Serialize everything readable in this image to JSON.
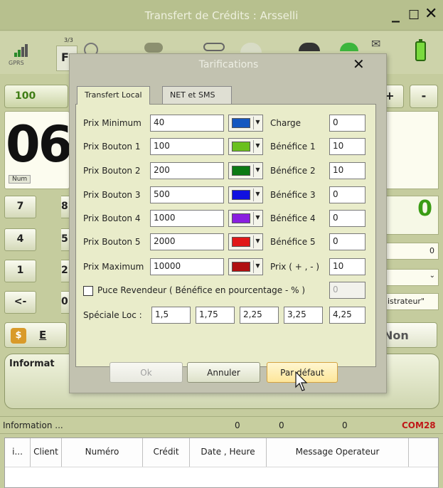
{
  "window": {
    "title": "Transfert de Crédits : Arsselli"
  },
  "toolbar": {
    "gprs": "GPRS",
    "page_count": "3/3",
    "p_label": "F"
  },
  "amounts": {
    "first": "100",
    "plus": "+",
    "minus": "-"
  },
  "display": {
    "number": "06",
    "num_badge": "Num"
  },
  "keypad": {
    "k7": "7",
    "k8": "8",
    "k4": "4",
    "k5": "5",
    "k1": "1",
    "k2": "2",
    "back": "<-",
    "k0": "0"
  },
  "right": {
    "balance": "0",
    "field1": "0",
    "field2": "",
    "field3": "ninistrateur\""
  },
  "money_button": {
    "icon_text": "$",
    "label": "E"
  },
  "non_button": {
    "label": "Non"
  },
  "info_panel": {
    "title": "Informat"
  },
  "statusbar": {
    "info": "Information ...",
    "c1": "0",
    "c2": "0",
    "c3": "0",
    "port": "COM28"
  },
  "table": {
    "columns": [
      "i...",
      "Client",
      "Numéro",
      "Crédit",
      "Date , Heure",
      "Message Operateur"
    ]
  },
  "dialog": {
    "title": "Tarifications",
    "tabs": [
      "Transfert Local",
      "NET et SMS"
    ],
    "rows": [
      {
        "label": "Prix Minimum",
        "value": "40",
        "color": "#1558c0",
        "rlabel": "Charge",
        "rvalue": "0"
      },
      {
        "label": "Prix Bouton 1",
        "value": "100",
        "color": "#6ac01c",
        "rlabel": "Bénéfice 1",
        "rvalue": "10"
      },
      {
        "label": "Prix Bouton 2",
        "value": "200",
        "color": "#0c7a14",
        "rlabel": "Bénéfice 2",
        "rvalue": "10"
      },
      {
        "label": "Prix Bouton 3",
        "value": "500",
        "color": "#1010e0",
        "rlabel": "Bénéfice 3",
        "rvalue": "0"
      },
      {
        "label": "Prix Bouton 4",
        "value": "1000",
        "color": "#8a1ee0",
        "rlabel": "Bénéfice 4",
        "rvalue": "0"
      },
      {
        "label": "Prix Bouton 5",
        "value": "2000",
        "color": "#e01818",
        "rlabel": "Bénéfice 5",
        "rvalue": "0"
      },
      {
        "label": "Prix Maximum",
        "value": "10000",
        "color": "#b01010",
        "rlabel": "Prix ( + , - )",
        "rvalue": "10"
      }
    ],
    "reseller": {
      "label": "Puce Revendeur ( Bénéfice en pourcentage - % )",
      "value": "0",
      "checked": false
    },
    "special": {
      "label": "Spéciale Loc :",
      "values": [
        "1,5",
        "1,75",
        "2,25",
        "3,25",
        "4,25"
      ]
    },
    "buttons": {
      "ok": "Ok",
      "cancel": "Annuler",
      "default": "Par défaut"
    }
  }
}
